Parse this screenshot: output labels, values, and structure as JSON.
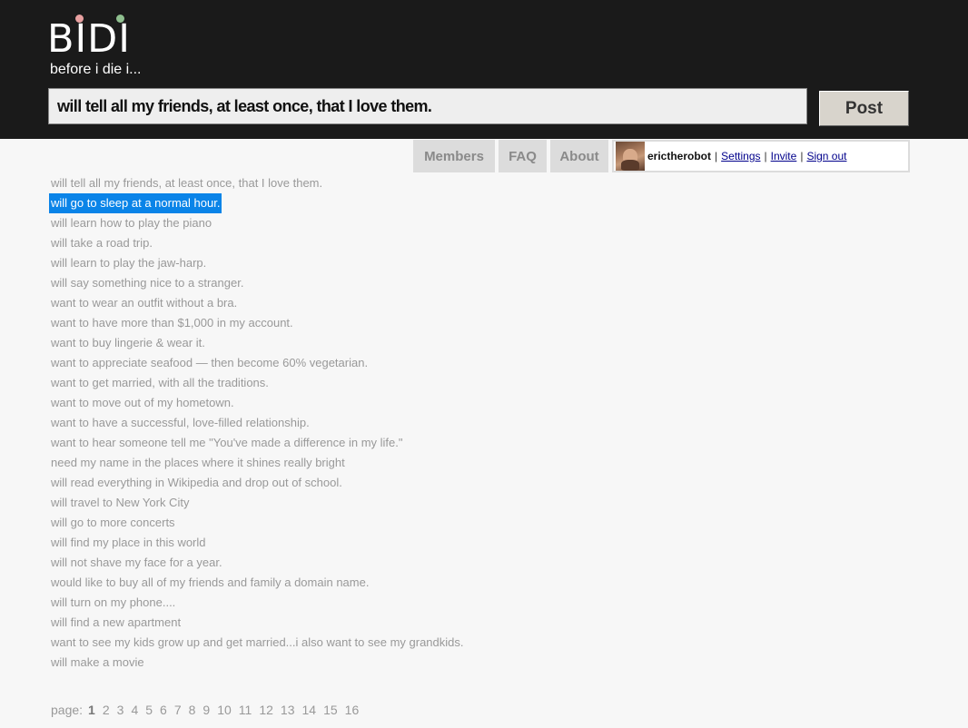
{
  "header": {
    "logo_text": "BIDI",
    "tagline": "before i die i...",
    "entry_value": "will tell all my friends, at least once, that I love them.",
    "post_label": "Post",
    "colors": {
      "background": "#1a1a1a",
      "logo_dot_pink": "#e8a0a0",
      "logo_dot_green": "#8fbf8f"
    }
  },
  "nav": {
    "tabs": [
      {
        "label": "Members"
      },
      {
        "label": "FAQ"
      },
      {
        "label": "About"
      }
    ]
  },
  "user": {
    "username": "erictherobot",
    "separator": "|",
    "links": [
      {
        "label": "Settings"
      },
      {
        "label": "Invite"
      },
      {
        "label": "Sign out"
      }
    ]
  },
  "entries": [
    "will tell all my friends, at least once, that I love them.",
    "will go to sleep at a normal hour.",
    "will learn how to play the piano",
    "will take a road trip.",
    "will learn to play the jaw-harp.",
    "will say something nice to a stranger.",
    "want to wear an outfit without a bra.",
    "want to have more than $1,000 in my account.",
    "want to buy lingerie & wear it.",
    "want to appreciate seafood — then become 60% vegetarian.",
    "want to get married, with all the traditions.",
    "want to move out of my hometown.",
    "want to have a successful, love-filled relationship.",
    "want to hear someone tell me \"You've made a difference in my life.\"",
    "need my name in the places where it shines really bright",
    "will read everything in Wikipedia and drop out of school.",
    "will travel to New York City",
    "will go to more concerts",
    "will find my place in this world",
    "will not shave my face for a year.",
    "would like to buy all of my friends and family a domain name.",
    "will turn on my phone....",
    "will find a new apartment",
    "want to see my kids grow up and get married...i also want to see my grandkids.",
    "will make a movie"
  ],
  "selected_entry_index": 1,
  "pagination": {
    "label": "page:",
    "current": "1",
    "pages": [
      "1",
      "2",
      "3",
      "4",
      "5",
      "6",
      "7",
      "8",
      "9",
      "10",
      "11",
      "12",
      "13",
      "14",
      "15",
      "16"
    ]
  }
}
